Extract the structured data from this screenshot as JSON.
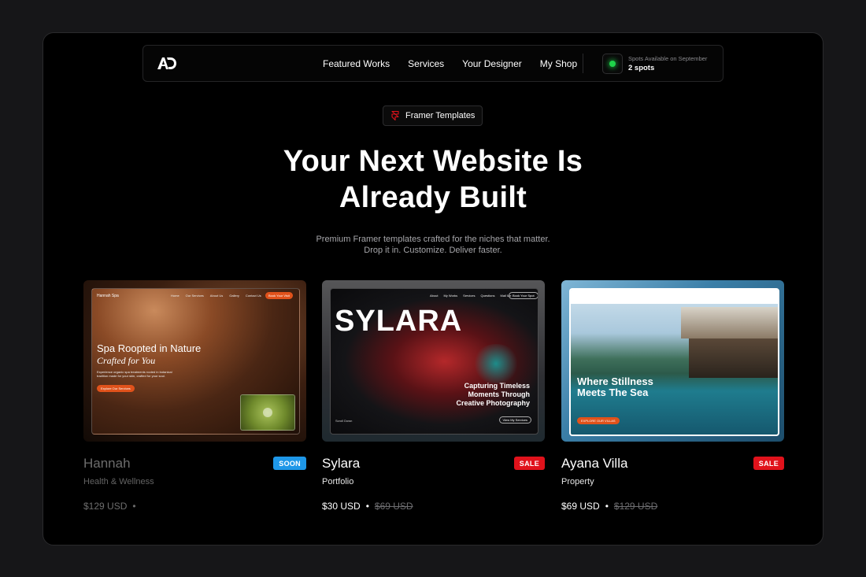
{
  "nav": {
    "links": [
      "Featured Works",
      "Services",
      "Your Designer",
      "My Shop"
    ],
    "spots_label": "Spots Available on September",
    "spots_value": "2 spots"
  },
  "badge": {
    "icon": "framer-icon",
    "label": "Framer Templates"
  },
  "hero": {
    "line1": "Your Next Website Is",
    "line2": "Already Built"
  },
  "subtitle": {
    "line1": "Premium Framer templates crafted for the niches that matter.",
    "line2": "Drop it in. Customize. Deliver faster."
  },
  "colors": {
    "accent_green": "#1fd34a",
    "soon": "#1e97e8",
    "sale": "#e0121b",
    "framer_red": "#e0121b"
  },
  "cards": [
    {
      "title": "Hannah",
      "category": "Health & Wellness",
      "price": "$129 USD",
      "old_price": "",
      "tag": "SOON",
      "preview": {
        "brand": "Hannah Spa",
        "nav": [
          "Home",
          "Our Services",
          "About Us",
          "Gallery",
          "Contact Us"
        ],
        "cta": "Book Your Visit",
        "headline1": "Spa Roopted in Nature",
        "headline2": "Crafted for You",
        "body": "Experience organic spa treatments rooted in botanical tradition made for your skin, crafted for your soul.",
        "button": "Explore Our Services"
      }
    },
    {
      "title": "Sylara",
      "category": "Portfolio",
      "price": "$30 USD",
      "old_price": "$69 USD",
      "tag": "SALE",
      "preview": {
        "nav": [
          "About",
          "My Works",
          "Services",
          "Questions",
          "Mail Me"
        ],
        "cta": "Book Your Spot",
        "brand": "SYLARA",
        "headline": [
          "Capturing Timeless",
          "Moments Through",
          "Creative Photography"
        ],
        "scroll": "Scroll Down",
        "button": "View My Services"
      }
    },
    {
      "title": "Ayana Villa",
      "category": "Property",
      "price": "$69 USD",
      "old_price": "$129 USD",
      "tag": "SALE",
      "preview": {
        "headline1": "Where Stillness",
        "headline2": "Meets The Sea",
        "button": "EXPLORE OUR VILLAS"
      }
    }
  ]
}
